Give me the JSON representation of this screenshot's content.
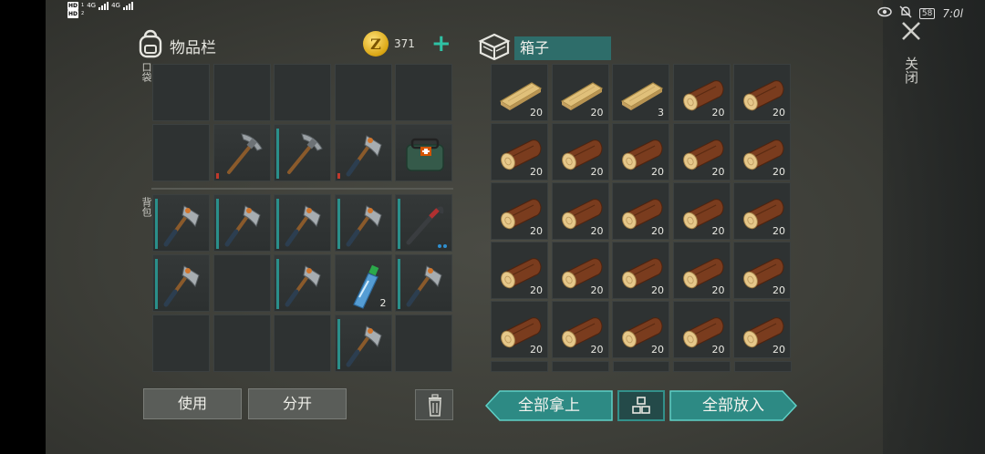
{
  "status_bar": {
    "hd1": "HD",
    "hd1_sub": "1",
    "hd2": "HD",
    "hd2_sub": "2",
    "net1": "4G",
    "net2": "4G",
    "battery": "58",
    "time": "7:0l"
  },
  "inventory": {
    "title": "物品栏",
    "icon": "backpack-icon",
    "coins": "371",
    "coin_symbol": "Z",
    "pocket_label": "口袋",
    "backpack_label": "背包",
    "pocket_slots": [
      {
        "item": "",
        "qty": ""
      },
      {
        "item": "",
        "qty": ""
      },
      {
        "item": "",
        "qty": ""
      },
      {
        "item": "",
        "qty": ""
      },
      {
        "item": "",
        "qty": ""
      },
      {
        "item": "",
        "qty": ""
      },
      {
        "item": "pickaxe",
        "qty": "",
        "durability": "red"
      },
      {
        "item": "pickaxe",
        "qty": "",
        "durability": "teal"
      },
      {
        "item": "hatchet",
        "qty": "",
        "durability": "red"
      },
      {
        "item": "medkit-bag",
        "qty": ""
      }
    ],
    "backpack_slots": [
      {
        "item": "hatchet",
        "qty": ""
      },
      {
        "item": "hatchet",
        "qty": ""
      },
      {
        "item": "hatchet",
        "qty": ""
      },
      {
        "item": "hatchet",
        "qty": ""
      },
      {
        "item": "crowbar",
        "qty": ""
      },
      {
        "item": "hatchet",
        "qty": ""
      },
      {
        "item": "",
        "qty": ""
      },
      {
        "item": "hatchet",
        "qty": ""
      },
      {
        "item": "water-bottle",
        "qty": "2"
      },
      {
        "item": "hatchet",
        "qty": ""
      },
      {
        "item": "",
        "qty": ""
      },
      {
        "item": "",
        "qty": ""
      },
      {
        "item": "",
        "qty": ""
      },
      {
        "item": "hatchet",
        "qty": ""
      },
      {
        "item": "",
        "qty": ""
      }
    ],
    "use_button": "使用",
    "split_button": "分开",
    "trash_icon": "trash-icon"
  },
  "chest": {
    "title": "箱子",
    "icon": "crate-icon",
    "slots": [
      {
        "item": "plank",
        "qty": "20"
      },
      {
        "item": "plank",
        "qty": "20"
      },
      {
        "item": "plank",
        "qty": "3"
      },
      {
        "item": "log",
        "qty": "20"
      },
      {
        "item": "log",
        "qty": "20"
      },
      {
        "item": "log",
        "qty": "20"
      },
      {
        "item": "log",
        "qty": "20"
      },
      {
        "item": "log",
        "qty": "20"
      },
      {
        "item": "log",
        "qty": "20"
      },
      {
        "item": "log",
        "qty": "20"
      },
      {
        "item": "log",
        "qty": "20"
      },
      {
        "item": "log",
        "qty": "20"
      },
      {
        "item": "log",
        "qty": "20"
      },
      {
        "item": "log",
        "qty": "20"
      },
      {
        "item": "log",
        "qty": "20"
      },
      {
        "item": "log",
        "qty": "20"
      },
      {
        "item": "log",
        "qty": "20"
      },
      {
        "item": "log",
        "qty": "20"
      },
      {
        "item": "log",
        "qty": "20"
      },
      {
        "item": "log",
        "qty": "20"
      },
      {
        "item": "log",
        "qty": "20"
      },
      {
        "item": "log",
        "qty": "20"
      },
      {
        "item": "log",
        "qty": "20"
      },
      {
        "item": "log",
        "qty": "20"
      },
      {
        "item": "log",
        "qty": "20"
      }
    ],
    "take_all_button": "全部拿上",
    "sort_icon": "grid-sort-icon",
    "put_all_button": "全部放入"
  },
  "close_label": "关闭",
  "colors": {
    "accent": "#2fc2a5",
    "teal_button": "#2d8a84",
    "durability_red": "#c0392b",
    "durability_teal": "#2a8f8a"
  }
}
